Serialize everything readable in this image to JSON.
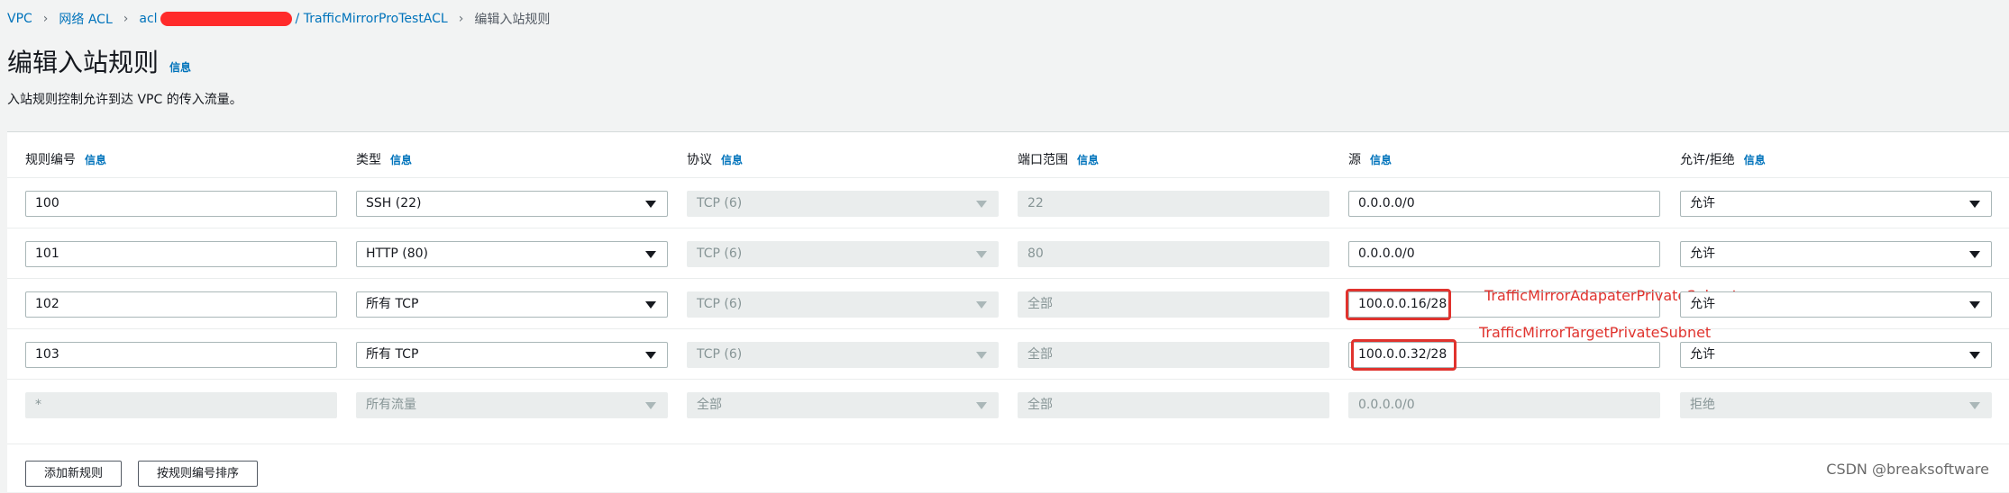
{
  "breadcrumb": {
    "items": [
      "VPC",
      "网络 ACL",
      "acl",
      "/ TrafficMirrorProTestACL"
    ],
    "current": "编辑入站规则"
  },
  "page": {
    "title": "编辑入站规则",
    "title_info": "信息",
    "description": "入站规则控制允许到达 VPC 的传入流量。"
  },
  "table": {
    "headers": [
      {
        "label": "规则编号",
        "info": "信息"
      },
      {
        "label": "类型",
        "info": "信息"
      },
      {
        "label": "协议",
        "info": "信息"
      },
      {
        "label": "端口范围",
        "info": "信息"
      },
      {
        "label": "源",
        "info": "信息"
      },
      {
        "label": "允许/拒绝",
        "info": "信息"
      }
    ],
    "rows": [
      {
        "rule": "100",
        "type": "SSH (22)",
        "protocol": "TCP (6)",
        "port": "22",
        "source": "0.0.0.0/0",
        "action": "允许"
      },
      {
        "rule": "101",
        "type": "HTTP (80)",
        "protocol": "TCP (6)",
        "port": "80",
        "source": "0.0.0.0/0",
        "action": "允许"
      },
      {
        "rule": "102",
        "type": "所有 TCP",
        "protocol": "TCP (6)",
        "port": "全部",
        "source": "100.0.0.16/28",
        "action": "允许"
      },
      {
        "rule": "103",
        "type": "所有 TCP",
        "protocol": "TCP (6)",
        "port": "全部",
        "source": "100.0.0.32/28",
        "action": "允许"
      },
      {
        "rule": "*",
        "type": "所有流量",
        "protocol": "全部",
        "port": "全部",
        "source": "0.0.0.0/0",
        "action": "拒绝"
      }
    ]
  },
  "annotations": {
    "row102": "TrafficMirrorAdapaterPrivateSubnet",
    "row103": "TrafficMirrorTargetPrivateSubnet"
  },
  "actions": {
    "add_rule": "添加新规则",
    "sort_rules": "按规则编号排序"
  },
  "watermark": "CSDN @breaksoftware",
  "colors": {
    "link": "#0073bb",
    "highlight": "#e0332e",
    "redaction": "#ff2a2a"
  }
}
